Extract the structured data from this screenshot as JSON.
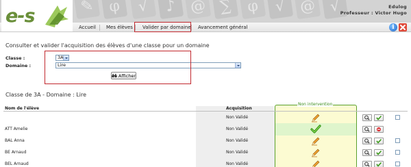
{
  "header": {
    "logo_text": "e-s",
    "user_line1": "Edulog",
    "user_line2": "Professeur : Victor Hugo"
  },
  "nav": {
    "items": [
      "Accueil",
      "Mes élèves",
      "Valider par domaine",
      "Avancement général"
    ],
    "active_index": 2
  },
  "form": {
    "heading": "Consulter et valider l'acquisition des élèves d'une classe pour un domaine",
    "class_label": "Classe :",
    "class_value": "3A",
    "domain_label": "Domaine :",
    "domain_value": "Lire",
    "show_button": "Afficher"
  },
  "results": {
    "heading": "Classe de 3A - Domaine : Lire",
    "no_intervention_label": "Non intervention",
    "columns": [
      "Nom de l'élève",
      "Acquisition"
    ],
    "rows": [
      {
        "name": "",
        "acquisition": "Non Validé",
        "state": "pencil"
      },
      {
        "name": "ATT Amelie",
        "acquisition": "Non Validé",
        "state": "validated"
      },
      {
        "name": "BAL Anna",
        "acquisition": "Non Validé",
        "state": "pencil"
      },
      {
        "name": "BE Arnaud",
        "acquisition": "Non Validé",
        "state": "pencil"
      },
      {
        "name": "BEL Arnaud",
        "acquisition": "Non Validé",
        "state": "pencil"
      }
    ]
  },
  "colors": {
    "highlight_frame": "#c1272d",
    "green": "#5aa02c",
    "no_intervention_bg": "#fcfbd2"
  }
}
